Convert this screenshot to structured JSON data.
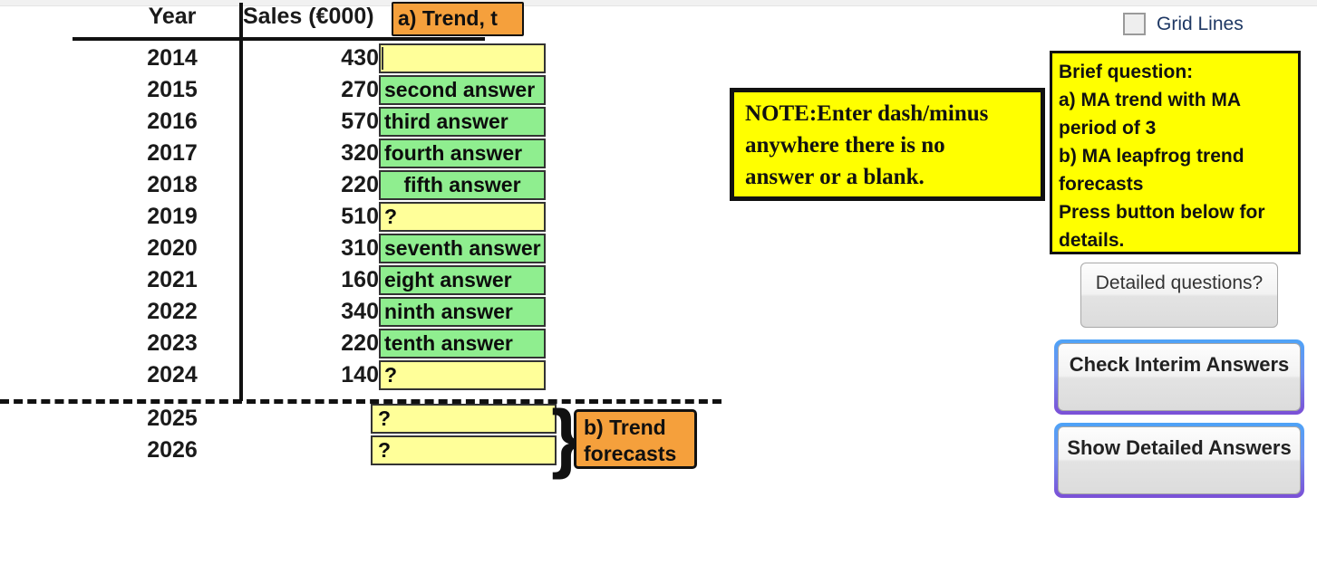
{
  "table": {
    "headers": {
      "year": "Year",
      "sales": "Sales (€000)"
    },
    "rows": [
      {
        "year": "2014",
        "sales": "430",
        "answer": "",
        "fill": "yellow"
      },
      {
        "year": "2015",
        "sales": "270",
        "answer": "second answer",
        "fill": "green"
      },
      {
        "year": "2016",
        "sales": "570",
        "answer": "third answer",
        "fill": "green"
      },
      {
        "year": "2017",
        "sales": "320",
        "answer": "fourth answer",
        "fill": "green"
      },
      {
        "year": "2018",
        "sales": "220",
        "answer": "fifth answer",
        "fill": "green"
      },
      {
        "year": "2019",
        "sales": "510",
        "answer": "?",
        "fill": "yellow"
      },
      {
        "year": "2020",
        "sales": "310",
        "answer": "seventh answer",
        "fill": "green"
      },
      {
        "year": "2021",
        "sales": "160",
        "answer": "eight answer",
        "fill": "green"
      },
      {
        "year": "2022",
        "sales": "340",
        "answer": "ninth answer",
        "fill": "green"
      },
      {
        "year": "2023",
        "sales": "220",
        "answer": "tenth answer",
        "fill": "green"
      },
      {
        "year": "2024",
        "sales": "140",
        "answer": "?",
        "fill": "yellow"
      }
    ],
    "forecast_rows": [
      {
        "year": "2025",
        "sales": "",
        "answer": "?"
      },
      {
        "year": "2026",
        "sales": "",
        "answer": "?"
      }
    ]
  },
  "callouts": {
    "trend_label": "a) Trend, t",
    "forecast_label": "b) Trend forecasts",
    "brace": "}"
  },
  "note": {
    "line1": "NOTE:Enter dash/minus",
    "line2": "anywhere there is no",
    "line3": "answer or a blank."
  },
  "panel": {
    "gridlines_label": "Grid Lines",
    "gridlines_checked": "false",
    "brief": {
      "line1": "Brief question:",
      "line2": "a) MA trend with MA",
      "line3": "period of 3",
      "line4": "b) MA leapfrog trend",
      "line5": "forecasts",
      "line6": "Press button below for",
      "line7": "details."
    },
    "buttons": {
      "detailed_questions": "Detailed questions?",
      "check_interim": "Check Interim Answers",
      "show_detailed": "Show Detailed Answers"
    }
  },
  "colors": {
    "answer_yellow": "#ffff99",
    "answer_green": "#8fee8f",
    "callout_orange": "#f5a03c",
    "note_yellow": "#ffff00",
    "focus_blue": "#4ea3f7",
    "focus_purple": "#7b4fd6"
  }
}
